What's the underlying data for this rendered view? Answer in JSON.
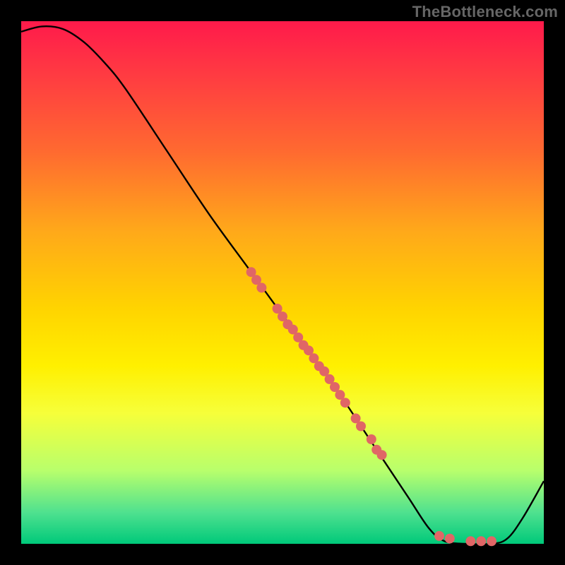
{
  "watermark": "TheBottleneck.com",
  "chart_data": {
    "type": "line",
    "title": "",
    "xlabel": "",
    "ylabel": "",
    "xlim": [
      0,
      100
    ],
    "ylim": [
      0,
      100
    ],
    "gradient_stops": [
      {
        "pos": 0,
        "color": "#ff1a4b"
      },
      {
        "pos": 10,
        "color": "#ff3a42"
      },
      {
        "pos": 25,
        "color": "#ff6a30"
      },
      {
        "pos": 40,
        "color": "#ffa81a"
      },
      {
        "pos": 55,
        "color": "#ffd400"
      },
      {
        "pos": 66,
        "color": "#fff000"
      },
      {
        "pos": 75,
        "color": "#f6ff3a"
      },
      {
        "pos": 86,
        "color": "#b8ff6c"
      },
      {
        "pos": 94,
        "color": "#4fe18f"
      },
      {
        "pos": 100,
        "color": "#00c97a"
      }
    ],
    "curve": [
      {
        "x": 0,
        "y": 98
      },
      {
        "x": 4,
        "y": 99
      },
      {
        "x": 8,
        "y": 98.5
      },
      {
        "x": 12,
        "y": 96
      },
      {
        "x": 16,
        "y": 92
      },
      {
        "x": 20,
        "y": 87
      },
      {
        "x": 28,
        "y": 75
      },
      {
        "x": 36,
        "y": 63
      },
      {
        "x": 44,
        "y": 52
      },
      {
        "x": 52,
        "y": 41
      },
      {
        "x": 60,
        "y": 30
      },
      {
        "x": 68,
        "y": 18
      },
      {
        "x": 74,
        "y": 9
      },
      {
        "x": 78,
        "y": 3
      },
      {
        "x": 81,
        "y": 0.5
      },
      {
        "x": 85,
        "y": 0
      },
      {
        "x": 90,
        "y": 0
      },
      {
        "x": 93,
        "y": 1
      },
      {
        "x": 96,
        "y": 5
      },
      {
        "x": 100,
        "y": 12
      }
    ],
    "points": [
      {
        "x": 44,
        "y": 52
      },
      {
        "x": 45,
        "y": 50.5
      },
      {
        "x": 46,
        "y": 49
      },
      {
        "x": 49,
        "y": 45
      },
      {
        "x": 50,
        "y": 43.5
      },
      {
        "x": 51,
        "y": 42
      },
      {
        "x": 52,
        "y": 41
      },
      {
        "x": 53,
        "y": 39.5
      },
      {
        "x": 54,
        "y": 38
      },
      {
        "x": 55,
        "y": 37
      },
      {
        "x": 56,
        "y": 35.5
      },
      {
        "x": 57,
        "y": 34
      },
      {
        "x": 58,
        "y": 33
      },
      {
        "x": 59,
        "y": 31.5
      },
      {
        "x": 60,
        "y": 30
      },
      {
        "x": 61,
        "y": 28.5
      },
      {
        "x": 62,
        "y": 27
      },
      {
        "x": 64,
        "y": 24
      },
      {
        "x": 65,
        "y": 22.5
      },
      {
        "x": 67,
        "y": 20
      },
      {
        "x": 68,
        "y": 18
      },
      {
        "x": 69,
        "y": 17
      },
      {
        "x": 80,
        "y": 1.5
      },
      {
        "x": 82,
        "y": 1
      },
      {
        "x": 86,
        "y": 0.5
      },
      {
        "x": 88,
        "y": 0.5
      },
      {
        "x": 90,
        "y": 0.5
      }
    ],
    "point_color": "#e06666",
    "curve_color": "#000000"
  }
}
